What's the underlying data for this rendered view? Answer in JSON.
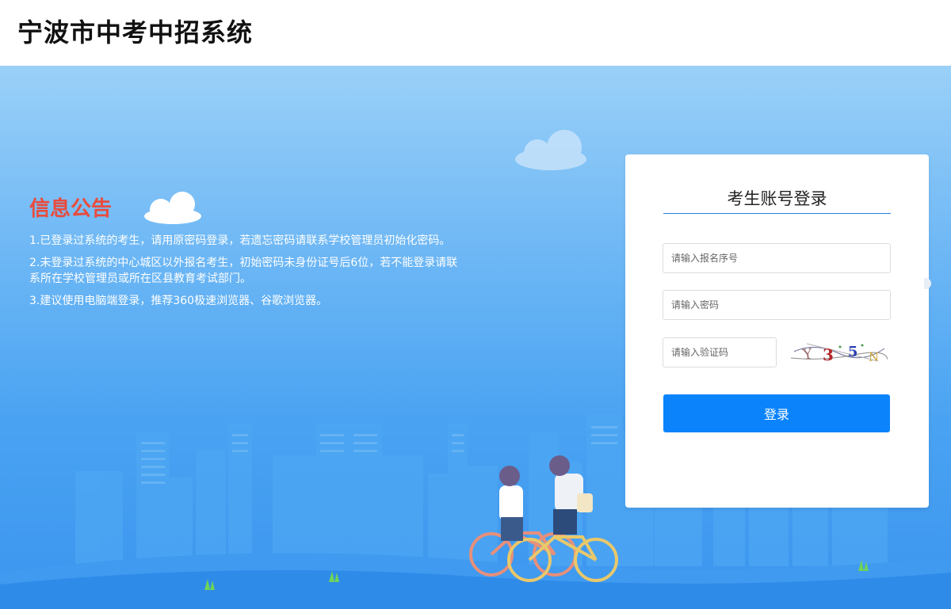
{
  "header": {
    "title": "宁波市中考中招系统"
  },
  "notice": {
    "title": "信息公告",
    "items": [
      "1.已登录过系统的考生，请用原密码登录，若遗忘密码请联系学校管理员初始化密码。",
      "2.未登录过系统的中心城区以外报名考生，初始密码未身份证号后6位，若不能登录请联系所在学校管理员或所在区县教育考试部门。",
      "3.建议使用电脑端登录，推荐360极速浏览器、谷歌浏览器。"
    ]
  },
  "login": {
    "title": "考生账号登录",
    "username_placeholder": "请输入报名序号",
    "password_placeholder": "请输入密码",
    "captcha_placeholder": "请输入验证码",
    "captcha_text": "Y 3 5 N",
    "submit_label": "登录"
  },
  "colors": {
    "accent": "#0b84fb",
    "notice_title": "#ea4b3c",
    "hero_top": "#9ad0f8",
    "hero_bottom": "#3b95ee"
  },
  "icons": [
    "cloud-icon",
    "grass-icon",
    "cyclists-illustration",
    "city-skyline-illustration"
  ]
}
